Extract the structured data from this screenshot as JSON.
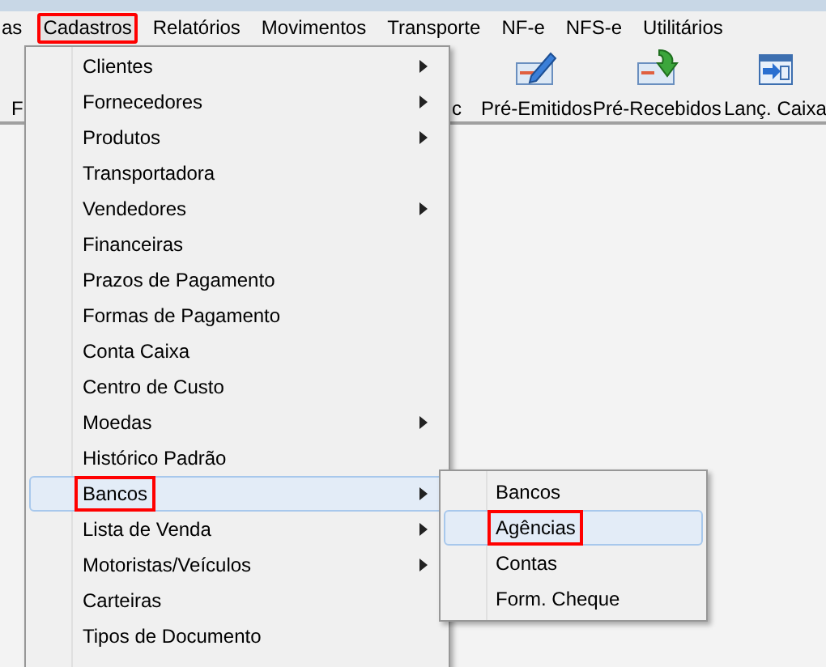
{
  "menubar": [
    {
      "label": "as",
      "selected": false,
      "outlined": false
    },
    {
      "label": "Cadastros",
      "selected": true,
      "outlined": true
    },
    {
      "label": "Relatórios",
      "selected": false,
      "outlined": false
    },
    {
      "label": "Movimentos",
      "selected": false,
      "outlined": false
    },
    {
      "label": "Transporte",
      "selected": false,
      "outlined": false
    },
    {
      "label": "NF-e",
      "selected": false,
      "outlined": false
    },
    {
      "label": "NFS-e",
      "selected": false,
      "outlined": false
    },
    {
      "label": "Utilitários",
      "selected": false,
      "outlined": false
    }
  ],
  "toolbar": [
    {
      "label": "F",
      "kind": "cut"
    },
    {
      "label": "c",
      "kind": "cut"
    },
    {
      "label": "Pré-Emitidos",
      "kind": "pen"
    },
    {
      "label": "Pré-Recebidos",
      "kind": "receive"
    },
    {
      "label": "Lanç. Caixa",
      "kind": "calendar"
    }
  ],
  "menu": [
    {
      "label": "Clientes",
      "has_submenu": true,
      "selected": false,
      "outlined": false
    },
    {
      "label": "Fornecedores",
      "has_submenu": true,
      "selected": false,
      "outlined": false
    },
    {
      "label": "Produtos",
      "has_submenu": true,
      "selected": false,
      "outlined": false
    },
    {
      "label": "Transportadora",
      "has_submenu": false,
      "selected": false,
      "outlined": false
    },
    {
      "label": "Vendedores",
      "has_submenu": true,
      "selected": false,
      "outlined": false
    },
    {
      "label": "Financeiras",
      "has_submenu": false,
      "selected": false,
      "outlined": false
    },
    {
      "label": "Prazos de Pagamento",
      "has_submenu": false,
      "selected": false,
      "outlined": false
    },
    {
      "label": "Formas de Pagamento",
      "has_submenu": false,
      "selected": false,
      "outlined": false
    },
    {
      "label": "Conta Caixa",
      "has_submenu": false,
      "selected": false,
      "outlined": false
    },
    {
      "label": "Centro de Custo",
      "has_submenu": false,
      "selected": false,
      "outlined": false
    },
    {
      "label": "Moedas",
      "has_submenu": true,
      "selected": false,
      "outlined": false
    },
    {
      "label": "Histórico Padrão",
      "has_submenu": false,
      "selected": false,
      "outlined": false
    },
    {
      "label": "Bancos",
      "has_submenu": true,
      "selected": true,
      "outlined": true
    },
    {
      "label": "Lista de Venda",
      "has_submenu": true,
      "selected": false,
      "outlined": false
    },
    {
      "label": "Motoristas/Veículos",
      "has_submenu": true,
      "selected": false,
      "outlined": false
    },
    {
      "label": "Carteiras",
      "has_submenu": false,
      "selected": false,
      "outlined": false
    },
    {
      "label": "Tipos de Documento",
      "has_submenu": false,
      "selected": false,
      "outlined": false
    }
  ],
  "submenu": [
    {
      "label": "Bancos",
      "selected": false,
      "outlined": false
    },
    {
      "label": "Agências",
      "selected": true,
      "outlined": true
    },
    {
      "label": "Contas",
      "selected": false,
      "outlined": false
    },
    {
      "label": "Form. Cheque",
      "selected": false,
      "outlined": false
    }
  ]
}
